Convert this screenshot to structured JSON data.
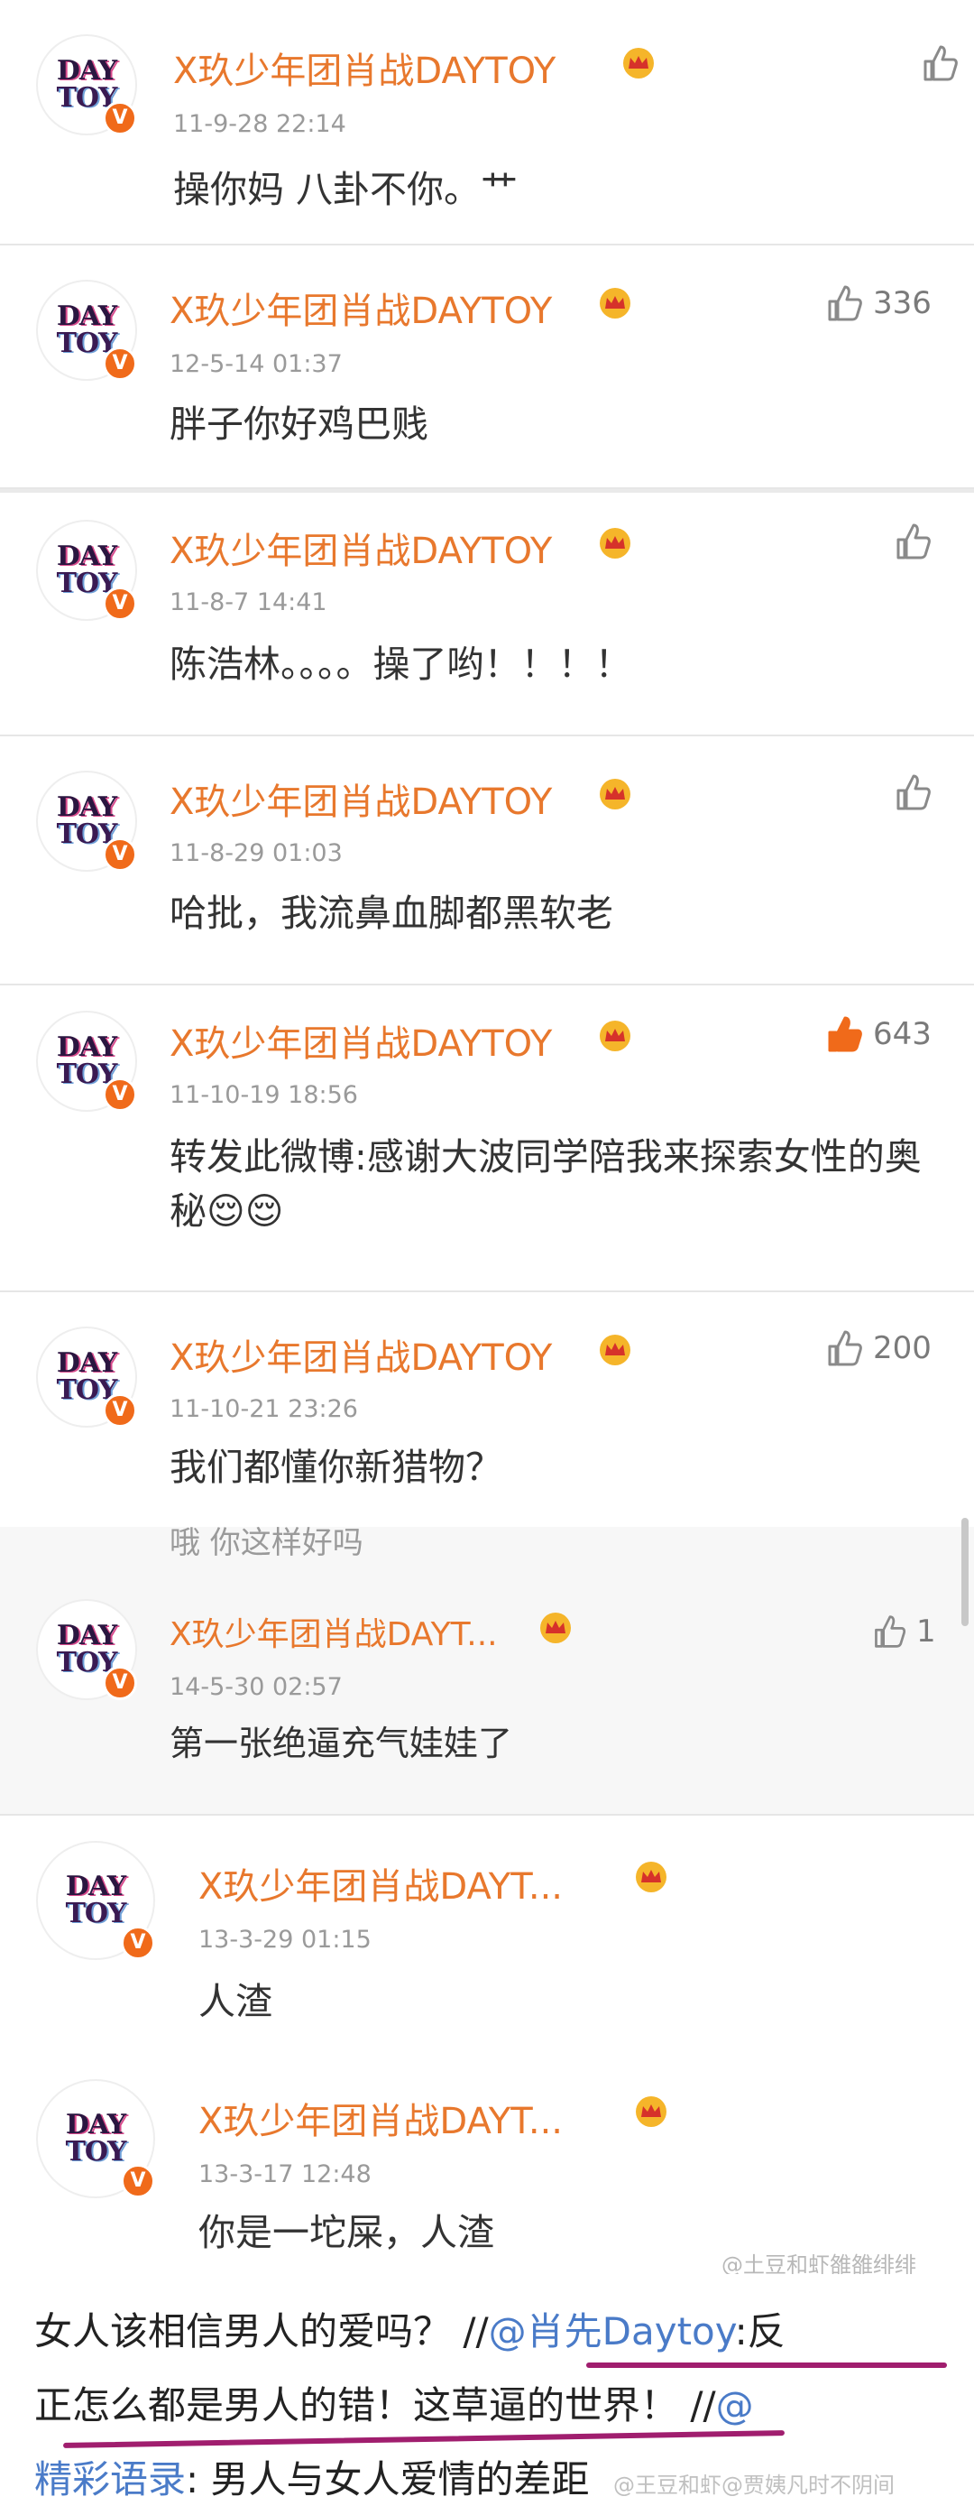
{
  "comments": [
    {
      "username": "X玖少年团肖战DAYTOY",
      "time": "11-9-28 22:14",
      "text": "操你妈  八卦不你。艹",
      "likes": ""
    },
    {
      "username": "X玖少年团肖战DAYTOY",
      "time": "12-5-14 01:37",
      "text": "胖子你好鸡巴贱",
      "likes": "336"
    },
    {
      "username": "X玖少年团肖战DAYTOY",
      "time": "11-8-7 14:41",
      "text": "陈浩林。。。。操了哟！！！！",
      "likes": ""
    },
    {
      "username": "X玖少年团肖战DAYTOY",
      "time": "11-8-29 01:03",
      "text": "哈批，我流鼻血脚都黑软老",
      "likes": ""
    },
    {
      "username": "X玖少年团肖战DAYTOY",
      "time": "11-10-19 18:56",
      "text": "转发此微博:感谢大波同学陪我来探索女性的奥秘😌😌",
      "likes": "643",
      "liked": true
    },
    {
      "username": "X玖少年团肖战DAYTOY",
      "time": "11-10-21 23:26",
      "text": "我们都懂你新猎物？",
      "likes": "200"
    },
    {
      "username": "X玖少年团肖战DAYT...",
      "time": "14-5-30 02:57",
      "text": "第一张绝逼充气娃娃了",
      "likes": "1",
      "partial_above": "哦 你这样好吗"
    },
    {
      "username": "X玖少年团肖战DAYT...",
      "time": "13-3-29 01:15",
      "text": "人渣",
      "likes": ""
    },
    {
      "username": "X玖少年团肖战DAYT...",
      "time": "13-3-17 12:48",
      "text": "你是一坨屎，人渣",
      "likes": ""
    }
  ],
  "avatar": {
    "line1": "DAY",
    "line2": "TOY",
    "badge": "V"
  },
  "footer": {
    "line1_prefix": "女人该相信男人的爱吗？ //",
    "line1_mention": "@肖先Daytoy",
    "line1_suffix": ":反",
    "line2": "正怎么都是男人的错！这草逼的世界！  //",
    "line2_mention": "@",
    "line3_mention": "精彩语录",
    "line3_suffix": ": 男人与女人爱情的差距"
  },
  "watermarks": {
    "top": "@土豆和虾雒雒绯绯",
    "bottom": "@王豆和虾@贾姨凡时不阴间"
  },
  "colors": {
    "username": "#e8782d",
    "liked": "#f06a1a",
    "mention": "#4a7bc8",
    "underline": "#a01e6e"
  }
}
